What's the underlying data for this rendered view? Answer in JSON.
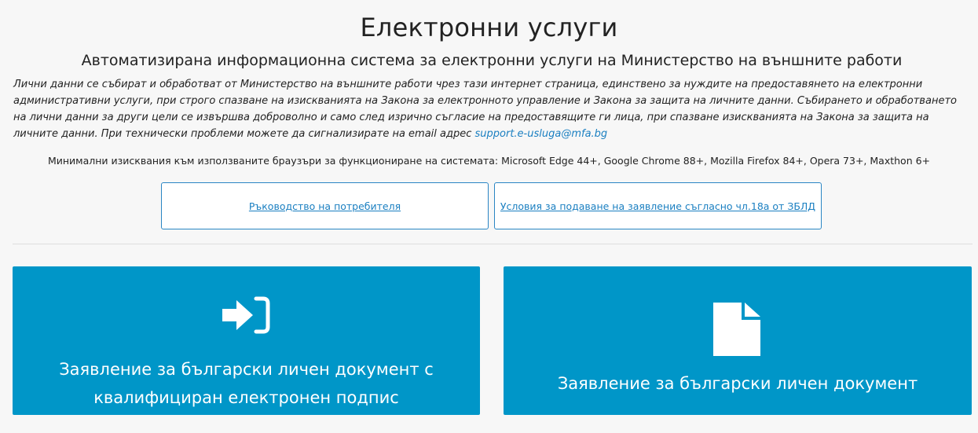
{
  "header": {
    "title": "Електронни услуги",
    "subtitle": "Автоматизирана информационна система за електронни услуги на Министерство на външните работи"
  },
  "notice": {
    "text": "Лични данни се събират и обработват от Министерство на външните работи чрез тази интернет страница, единствено за нуждите на предоставянето на електронни административни услуги, при строго спазване на изискванията на Закона за електронното управление и Закона за защита на личните данни. Събирането и обработването на лични данни за други цели се извършва доброволно и само след изрично съгласие на предоставящите ги лица, при спазване изискванията на Закона за защита на личните данни. При технически проблеми можете да сигнализирате на email адрес ",
    "email": "support.e-usluga@mfa.bg"
  },
  "requirements": "Минимални изисквания към използваните браузъри за функциониране на системата: Microsoft Edge 44+, Google Chrome 88+, Mozilla Firefox 84+, Opera 73+, Maxthon 6+",
  "links": {
    "manual": "Ръководство на потребителя",
    "terms": "Условия за подаване на заявление съгласно чл.18а от ЗБЛД"
  },
  "services": [
    {
      "label": "Заявление за български личен документ с квалифициран електронен подпис",
      "icon": "sign-in-icon"
    },
    {
      "label": "Заявление за български личен документ",
      "icon": "document-icon"
    }
  ],
  "colors": {
    "accent": "#0096c8",
    "link": "#1a7fc1",
    "background": "#f7f7f7"
  }
}
